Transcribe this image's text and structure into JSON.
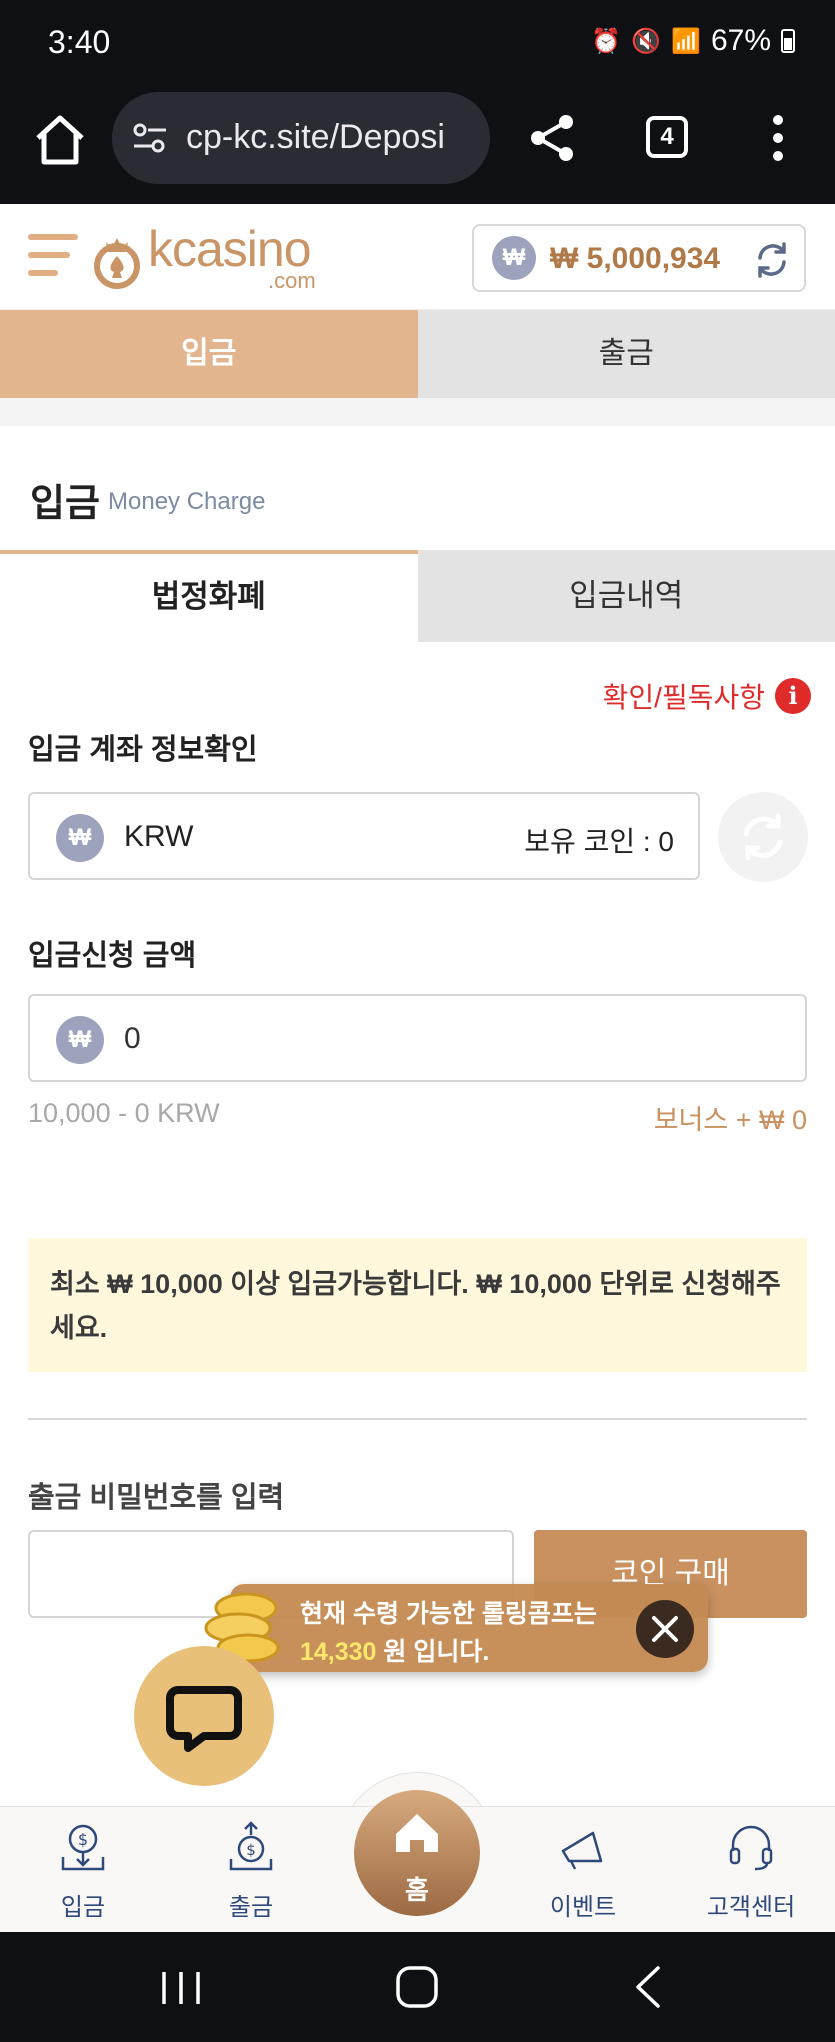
{
  "status_bar": {
    "time": "3:40",
    "battery": "67%"
  },
  "browser": {
    "url": "cp-kc.site/Deposi",
    "tab_count": "4"
  },
  "header": {
    "logo_text": "kcasino",
    "logo_suffix": ".com",
    "currency_symbol": "₩",
    "balance": "₩ 5,000,934"
  },
  "top_tabs": [
    {
      "label": "입금",
      "active": true
    },
    {
      "label": "출금",
      "active": false
    }
  ],
  "section": {
    "title": "입금",
    "subtitle": "Money Charge"
  },
  "sub_tabs": [
    {
      "label": "법정화폐",
      "active": true
    },
    {
      "label": "입금내역",
      "active": false
    }
  ],
  "notice_link": {
    "label": "확인/필독사항",
    "icon": "i"
  },
  "account_info": {
    "label": "입금 계좌 정보확인",
    "currency": "KRW",
    "held_coin": "보유 코인 : 0"
  },
  "amount": {
    "label": "입금신청 금액",
    "value": "0",
    "range": "10,000 - 0 KRW",
    "bonus": "보너스 + ₩ 0"
  },
  "warning": "최소 ₩ 10,000 이상 입금가능합니다. ₩ 10,000 단위로 신청해주세요.",
  "password": {
    "label": "출금 비밀번호를 입력",
    "value": ""
  },
  "buy_button": "코인 구매",
  "toast": {
    "line1": "현재 수령 가능한 롤링콤프는",
    "amount": "14,330",
    "line2_suffix": " 원 입니다."
  },
  "bottom_nav": {
    "deposit": "입금",
    "withdraw": "출금",
    "home": "홈",
    "event": "이벤트",
    "support": "고객센터"
  },
  "colors": {
    "accent": "#e3b58e",
    "accent_dark": "#c8915f",
    "notice_red": "#e02b2b",
    "nav_blue": "#2e4a7a"
  }
}
